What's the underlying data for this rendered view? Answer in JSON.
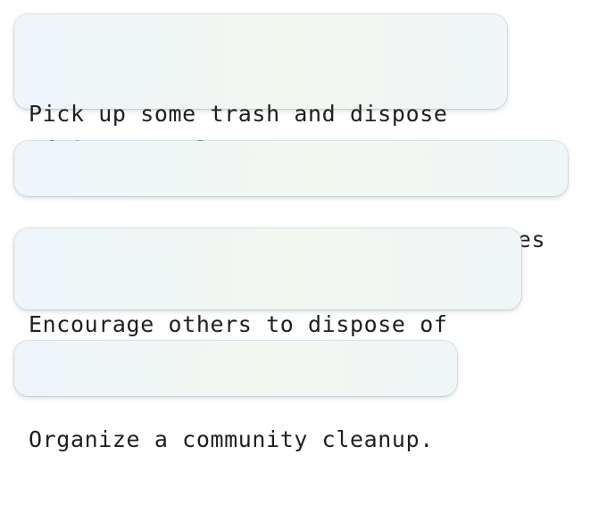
{
  "options": [
    {
      "text": "Pick up some trash and dispose\nof it properly."
    },
    {
      "text": "Report the issue to local authorities"
    },
    {
      "text": "Encourage others to dispose of\ntheir waster properly."
    },
    {
      "text": "Organize a community cleanup."
    }
  ]
}
